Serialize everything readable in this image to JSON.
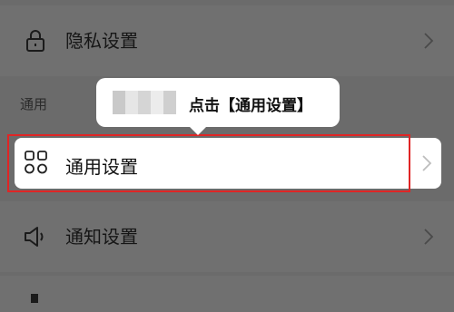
{
  "rows": {
    "privacy": {
      "label": "隐私设置",
      "icon": "lock-icon"
    },
    "general": {
      "label": "通用设置",
      "icon": "grid-icon"
    },
    "notify": {
      "label": "通知设置",
      "icon": "speaker-icon"
    }
  },
  "section": {
    "general_header": "通用"
  },
  "tooltip": {
    "text": "点击【通用设置】"
  },
  "colors": {
    "overlay": "#6b6b6b",
    "highlight_border": "#e02525",
    "card_bg": "#ffffff"
  }
}
